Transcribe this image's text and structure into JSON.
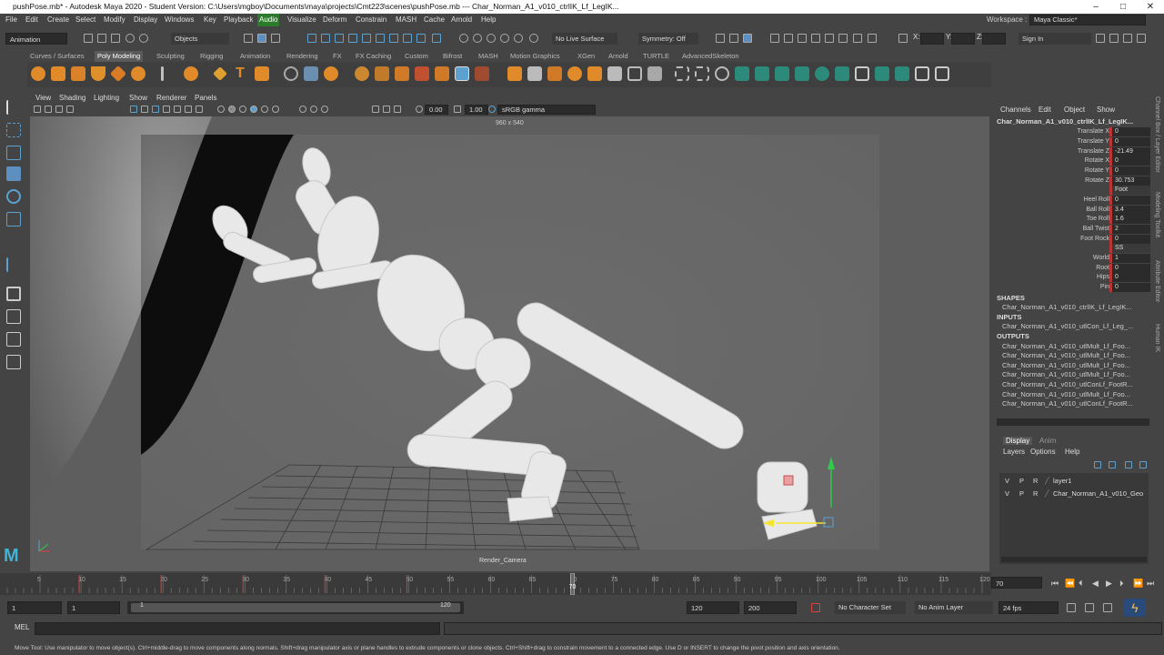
{
  "window": {
    "title": "pushPose.mb* - Autodesk Maya 2020 - Student Version: C:\\Users\\mgboy\\Documents\\maya\\projects\\Cmt223\\scenes\\pushPose.mb   ---   Char_Norman_A1_v010_ctrlIK_Lf_LegIK...",
    "min": "–",
    "max": "□",
    "close": "✕"
  },
  "menu": [
    "File",
    "Edit",
    "Create",
    "Select",
    "Modify",
    "Display",
    "Windows",
    "Key",
    "Playback",
    "Audio",
    "Visualize",
    "Deform",
    "Constrain",
    "MASH",
    "Cache",
    "Arnold",
    "Help"
  ],
  "workspace": {
    "label": "Workspace :",
    "value": "Maya Classic*"
  },
  "status": {
    "menuset": "Animation",
    "select_mode": "Objects",
    "live_surface": "No Live Surface",
    "symmetry": "Symmetry: Off",
    "x": "X:",
    "y": "Y:",
    "z": "Z:",
    "sign_in": "Sign In"
  },
  "shelf_tabs": [
    "Curves / Surfaces",
    "Poly Modeling",
    "Sculpting",
    "Rigging",
    "Animation",
    "Rendering",
    "FX",
    "FX Caching",
    "Custom",
    "Bifrost",
    "MASH",
    "Motion Graphics",
    "XGen",
    "Arnold",
    "TURTLE",
    "AdvancedSkeleton"
  ],
  "panel_menu": [
    "View",
    "Shading",
    "Lighting",
    "Show",
    "Renderer",
    "Panels"
  ],
  "panel_tool": {
    "exposure": "0.00",
    "gamma": "1.00",
    "colorspace": "sRGB gamma"
  },
  "viewport": {
    "resolution": "960 x 540",
    "camera": "Render_Camera"
  },
  "channel_box": {
    "menu": [
      "Channels",
      "Edit",
      "Object",
      "Show"
    ],
    "object": "Char_Norman_A1_v010_ctrlIK_Lf_LegIK...",
    "attrs": [
      {
        "name": "Translate X",
        "value": "0"
      },
      {
        "name": "Translate Y",
        "value": "0"
      },
      {
        "name": "Translate Z",
        "value": "-21.49"
      },
      {
        "name": "Rotate X",
        "value": "0"
      },
      {
        "name": "Rotate Y",
        "value": "0"
      },
      {
        "name": "Rotate Z",
        "value": "30.753"
      }
    ],
    "sep1": "Foot",
    "attrs2": [
      {
        "name": "Heel Roll",
        "value": "0"
      },
      {
        "name": "Ball Roll",
        "value": "3.4"
      },
      {
        "name": "Toe Roll",
        "value": "1.6"
      },
      {
        "name": "Ball Twist",
        "value": "2"
      },
      {
        "name": "Foot Rock",
        "value": "0"
      }
    ],
    "sep2": "SS",
    "attrs3": [
      {
        "name": "World",
        "value": "1"
      },
      {
        "name": "Root",
        "value": "0"
      },
      {
        "name": "Hips",
        "value": "0"
      },
      {
        "name": "Pin",
        "value": "0"
      }
    ],
    "shapes_label": "SHAPES",
    "shapes": [
      "Char_Norman_A1_v010_ctrlIK_Lf_LegIK..."
    ],
    "inputs_label": "INPUTS",
    "inputs": [
      "Char_Norman_A1_v010_utlCon_Lf_Leg_..."
    ],
    "outputs_label": "OUTPUTS",
    "outputs": [
      "Char_Norman_A1_v010_utlMult_Lf_Foo...",
      "Char_Norman_A1_v010_utlMult_Lf_Foo...",
      "Char_Norman_A1_v010_utlMult_Lf_Foo...",
      "Char_Norman_A1_v010_utlMult_Lf_Foo...",
      "Char_Norman_A1_v010_utlConLf_FootR...",
      "Char_Norman_A1_v010_utlMult_Lf_Foo...",
      "Char_Norman_A1_v010_utlConLf_FootR..."
    ]
  },
  "side_tabs": [
    "Channel Box / Layer Editor",
    "Modeling Toolkit",
    "Attribute Editor",
    "Human IK"
  ],
  "layer_editor": {
    "tabs": [
      "Display",
      "Anim"
    ],
    "menu": [
      "Layers",
      "Options",
      "Help"
    ],
    "layers": [
      {
        "v": "V",
        "p": "P",
        "r": "R",
        "name": "layer1"
      },
      {
        "v": "V",
        "p": "P",
        "r": "R",
        "name": "Char_Norman_A1_v010_Geo"
      }
    ]
  },
  "timeline": {
    "ticks": [
      "5",
      "10",
      "15",
      "20",
      "25",
      "30",
      "35",
      "40",
      "45",
      "50",
      "55",
      "60",
      "65",
      "70",
      "75",
      "80",
      "85",
      "90",
      "95",
      "100",
      "105",
      "110",
      "115",
      "120"
    ],
    "current": "70",
    "current_frame": 70,
    "start": 1,
    "end": 120
  },
  "range": {
    "start": "1",
    "anim_start": "1",
    "slider_start": "1",
    "slider_end": "120",
    "end": "120",
    "anim_end": "200",
    "char_set": "No Character Set",
    "anim_layer": "No Anim Layer",
    "fps": "24 fps"
  },
  "mel": {
    "label": "MEL"
  },
  "help_line": "Move Tool: Use manipulator to move object(s). Ctrl+middle-drag to move components along normals. Shift+drag manipulator axis or plane handles to extrude components or clone objects. Ctrl+Shift+drag to constrain movement to a connected edge. Use D or INSERT to change the pivot position and axis orientation.",
  "colors": {
    "bg": "#444444",
    "accent": "#5da1d1",
    "key": "#d94040",
    "current_frame": "#e0e0e0"
  }
}
